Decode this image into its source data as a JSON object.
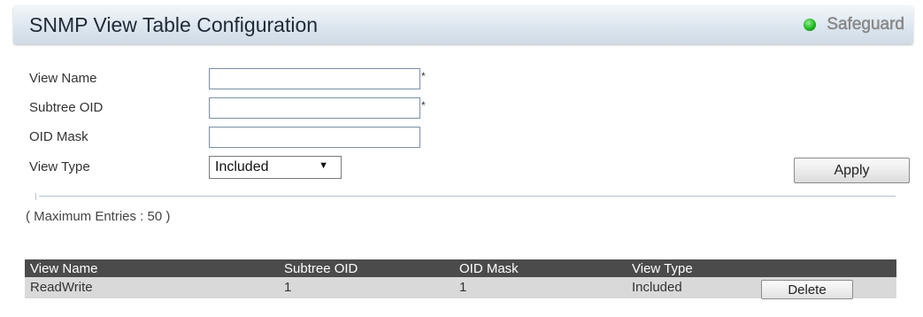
{
  "header": {
    "title": "SNMP View Table Configuration",
    "safeguard_label": "Safeguard",
    "safeguard_color": "#1fb51f"
  },
  "form": {
    "view_name_label": "View Name",
    "view_name_value": "",
    "subtree_oid_label": "Subtree OID",
    "subtree_oid_value": "",
    "oid_mask_label": "OID Mask",
    "oid_mask_value": "",
    "view_type_label": "View Type",
    "view_type_value": "Included",
    "required_mark": "*",
    "apply_label": "Apply"
  },
  "max_entries_text": "( Maximum Entries : 50 )",
  "table": {
    "headers": [
      "View Name",
      "Subtree OID",
      "OID Mask",
      "View Type"
    ],
    "rows": [
      {
        "view_name": "ReadWrite",
        "subtree_oid": "1",
        "oid_mask": "1",
        "view_type": "Included",
        "action": "Delete"
      }
    ]
  }
}
